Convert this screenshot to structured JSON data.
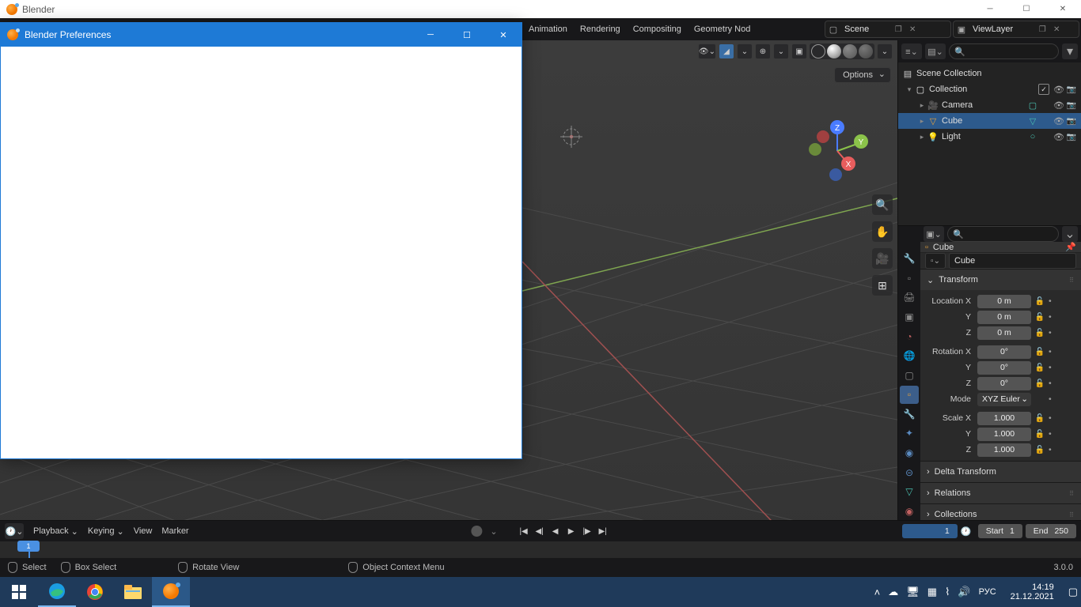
{
  "window": {
    "title": "Blender"
  },
  "prefs": {
    "title": "Blender Preferences"
  },
  "topbar": {
    "menus": [
      "Animation",
      "Rendering",
      "Compositing",
      "Geometry Nod"
    ],
    "scene_label": "Scene",
    "layer_label": "ViewLayer"
  },
  "viewport": {
    "options": "Options"
  },
  "outliner": {
    "scene_collection": "Scene Collection",
    "collection": "Collection",
    "items": [
      {
        "label": "Camera"
      },
      {
        "label": "Cube"
      },
      {
        "label": "Light"
      }
    ]
  },
  "props": {
    "breadcrumb": "Cube",
    "name_field": "Cube",
    "panels": {
      "transform": "Transform",
      "delta": "Delta Transform",
      "relations": "Relations",
      "collections": "Collections"
    },
    "rows": {
      "locx": "Location X",
      "locy": "Y",
      "locz": "Z",
      "rotx": "Rotation X",
      "roty": "Y",
      "rotz": "Z",
      "mode": "Mode",
      "mode_val": "XYZ Euler",
      "sclx": "Scale X",
      "scly": "Y",
      "sclz": "Z"
    },
    "vals": {
      "loc": "0 m",
      "rot": "0°",
      "scl": "1.000"
    }
  },
  "timeline": {
    "menus": {
      "playback": "Playback",
      "keying": "Keying",
      "view": "View",
      "marker": "Marker"
    },
    "current": "1",
    "start_lbl": "Start",
    "start": "1",
    "end_lbl": "End",
    "end": "250"
  },
  "status": {
    "select": "Select",
    "box": "Box Select",
    "rotate": "Rotate View",
    "ctx": "Object Context Menu",
    "version": "3.0.0"
  },
  "tray": {
    "lang": "РУС",
    "time": "14:19",
    "date": "21.12.2021"
  }
}
